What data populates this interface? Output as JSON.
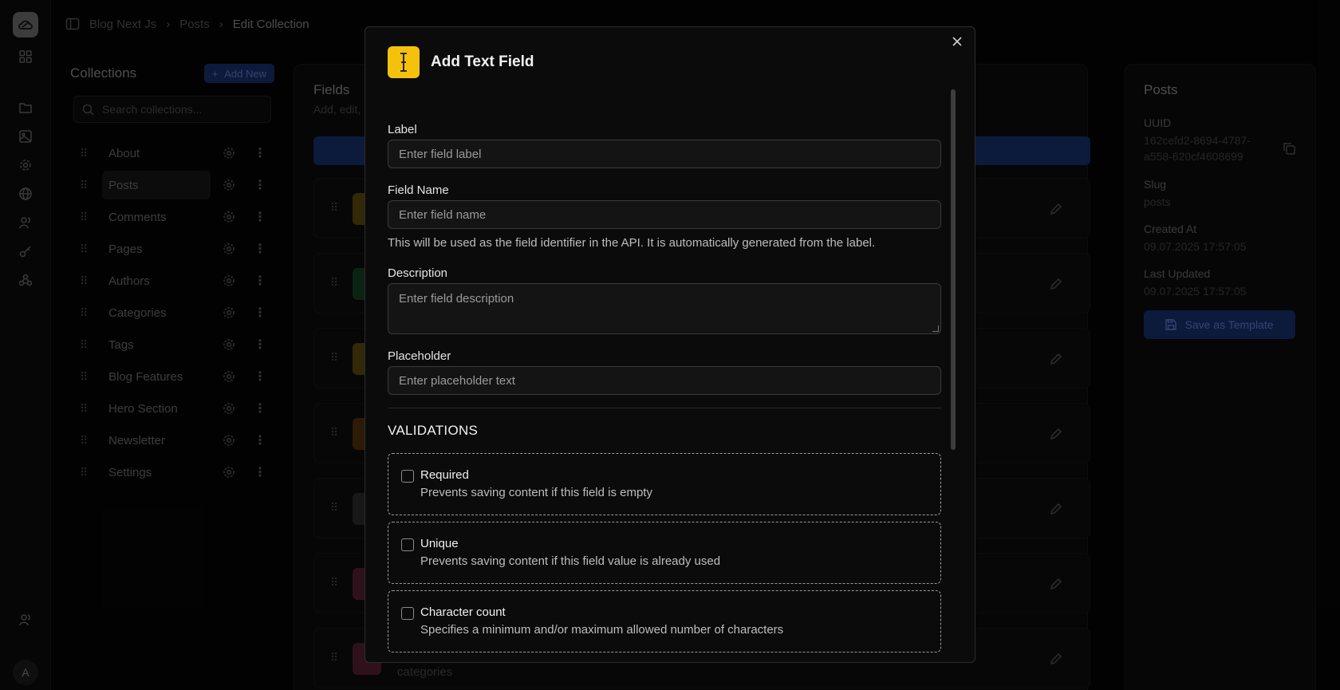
{
  "breadcrumb": {
    "items": [
      "Blog Next Js",
      "Posts",
      "Edit Collection"
    ]
  },
  "collections": {
    "title": "Collections",
    "add_new_label": "Add New",
    "search_placeholder": "Search collections...",
    "items": [
      {
        "label": "About"
      },
      {
        "label": "Posts",
        "active": true
      },
      {
        "label": "Comments"
      },
      {
        "label": "Pages"
      },
      {
        "label": "Authors"
      },
      {
        "label": "Categories"
      },
      {
        "label": "Tags"
      },
      {
        "label": "Blog Features"
      },
      {
        "label": "Hero Section"
      },
      {
        "label": "Newsletter"
      },
      {
        "label": "Settings"
      }
    ]
  },
  "fields_panel": {
    "title": "Fields",
    "subtitle": "Add, edit,",
    "rows": [
      {
        "icon_color": "#f4c20d",
        "text": ""
      },
      {
        "icon_color": "#22a35a",
        "text": ""
      },
      {
        "icon_color": "#f4c20d",
        "text": ""
      },
      {
        "icon_color": "#d97706",
        "text": ""
      },
      {
        "icon_color": "#6b6b6b",
        "text": ""
      },
      {
        "icon_color": "#e0457b",
        "text": ""
      },
      {
        "icon_color": "#e0457b",
        "text": "categories"
      }
    ]
  },
  "posts_panel": {
    "title": "Posts",
    "uuid_label": "UUID",
    "uuid_value_line1": "162cefd2-8694-4787-",
    "uuid_value_line2": "a558-620cf4608699",
    "slug_label": "Slug",
    "slug_value": "posts",
    "created_label": "Created At",
    "created_value": "09.07.2025 17:57:05",
    "updated_label": "Last Updated",
    "updated_value": "09.07.2025 17:57:05",
    "save_template_label": "Save as Template"
  },
  "modal": {
    "title": "Add Text Field",
    "icon_color": "#f4c20d",
    "label_label": "Label",
    "label_placeholder": "Enter field label",
    "field_name_label": "Field Name",
    "field_name_placeholder": "Enter field name",
    "field_name_help": "This will be used as the field identifier in the API. It is automatically generated from the label.",
    "description_label": "Description",
    "description_placeholder": "Enter field description",
    "placeholder_label": "Placeholder",
    "placeholder_placeholder": "Enter placeholder text",
    "validations_title": "VALIDATIONS",
    "validations": [
      {
        "title": "Required",
        "description": "Prevents saving content if this field is empty",
        "checked": false
      },
      {
        "title": "Unique",
        "description": "Prevents saving content if this field value is already used",
        "checked": false
      },
      {
        "title": "Character count",
        "description": "Specifies a minimum and/or maximum allowed number of characters",
        "checked": false
      }
    ]
  },
  "user": {
    "avatar_initial": "A"
  },
  "colors": {
    "accent": "#1e40af",
    "brand_yellow": "#f4c20d"
  }
}
